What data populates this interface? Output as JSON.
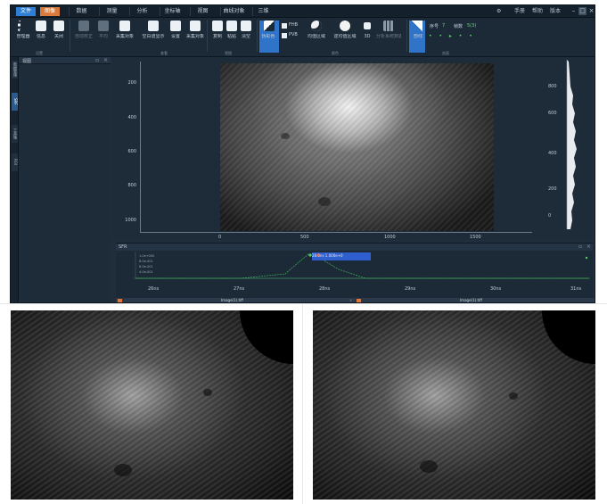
{
  "menubar": {
    "items": [
      {
        "label": "文件",
        "state": "active"
      },
      {
        "label": "图像",
        "state": "highlight"
      },
      {
        "label": "数据",
        "state": "normal"
      },
      {
        "label": "测量",
        "state": "normal"
      },
      {
        "label": "分析",
        "state": "normal"
      },
      {
        "label": "坐标轴",
        "state": "normal"
      },
      {
        "label": "视图",
        "state": "normal"
      },
      {
        "label": "曲线对象",
        "state": "normal"
      },
      {
        "label": "三维",
        "state": "normal"
      }
    ],
    "right": [
      "手册",
      "帮助",
      "版本"
    ]
  },
  "ribbon": {
    "buttons": [
      {
        "label": "管理器",
        "state": "normal"
      },
      {
        "label": "信息",
        "state": "normal"
      },
      {
        "label": "关闭",
        "state": "normal"
      },
      {
        "label": "自动校正",
        "state": "dim"
      },
      {
        "label": "平均",
        "state": "dim"
      },
      {
        "label": "采集对象",
        "state": "dim"
      },
      {
        "label": "空白谱显示",
        "state": "dim"
      },
      {
        "label": "设置",
        "state": "dim"
      },
      {
        "label": "采集对象",
        "state": "dim"
      },
      {
        "label": "复制",
        "state": "dim"
      },
      {
        "label": "粘贴",
        "state": "dim"
      },
      {
        "label": "清空",
        "state": "dim"
      },
      {
        "label": "伪彩色",
        "state": "selected"
      },
      {
        "label": "均值区域",
        "state": "normal"
      },
      {
        "label": "逆均值区域",
        "state": "normal"
      },
      {
        "label": "3D",
        "state": "normal"
      },
      {
        "label": "分析系统数据",
        "state": "dim"
      },
      {
        "label": "剖线",
        "state": "selected"
      }
    ],
    "checks": [
      "FHB",
      "PVB"
    ],
    "groups": [
      "设置",
      "查看",
      "视图",
      "颜色",
      "剖面"
    ],
    "fields": [
      {
        "label": "序号",
        "value": "7"
      },
      {
        "label": "帧数",
        "value": "5(3)"
      }
    ]
  },
  "left_panel": {
    "title": "视图",
    "tabs": [
      "数据管理",
      "SRF",
      "工具箱",
      "ROI"
    ]
  },
  "viewer": {
    "y_ticks": [
      "200",
      "400",
      "600",
      "800",
      "1000"
    ],
    "x_ticks": [
      "0",
      "500",
      "1000",
      "1500"
    ],
    "hist_ticks": [
      "800",
      "600",
      "400",
      "200",
      "0"
    ]
  },
  "sfr": {
    "title": "SFR",
    "x_ticks": [
      "26ns",
      "27ns",
      "28ns",
      "29ns",
      "30ns",
      "31ns"
    ],
    "tooltip": "28.0ns 1.000e+0",
    "accent": "#2f7fd6"
  },
  "status": {
    "left": "Image(1).tiff",
    "right": "Image(1).tiff"
  }
}
